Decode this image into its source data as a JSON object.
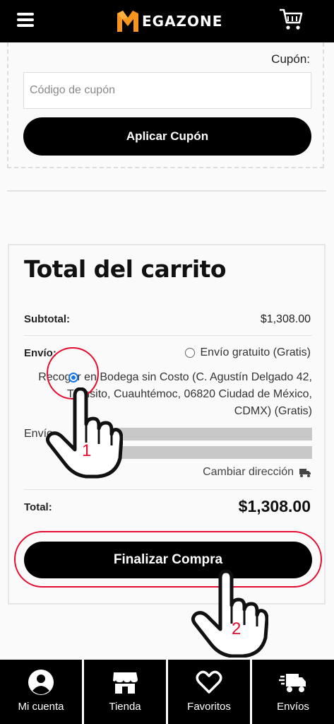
{
  "header": {
    "logo_text": "EGAZONE",
    "logo_letter": "M"
  },
  "coupon": {
    "label": "Cupón:",
    "placeholder": "Código de cupón",
    "apply_button": "Aplicar Cupón"
  },
  "totals": {
    "title": "Total del carrito",
    "subtotal_label": "Subtotal:",
    "subtotal_value": "$1,308.00",
    "shipping_label": "Envío:",
    "shipping_options": [
      {
        "label": "Envío gratuito (Gratis)",
        "selected": false
      },
      {
        "label": "Recoger en Bodega sin Costo (C. Agustín Delgado 42, Tránsito, Cuauhtémoc, 06820 Ciudad de México, CDMX) (Gratis)",
        "selected": true
      }
    ],
    "ship_to_label": "Envío",
    "change_address": "Cambiar dirección",
    "total_label": "Total:",
    "total_value": "$1,308.00",
    "checkout_button": "Finalizar Compra"
  },
  "annotations": {
    "step1": "1",
    "step2": "2",
    "accent_color": "#e30d2f"
  },
  "bottom_nav": [
    {
      "label": "Mi cuenta",
      "icon": "user-icon"
    },
    {
      "label": "Tienda",
      "icon": "store-icon"
    },
    {
      "label": "Favoritos",
      "icon": "heart-icon"
    },
    {
      "label": "Envíos",
      "icon": "truck-icon"
    }
  ]
}
